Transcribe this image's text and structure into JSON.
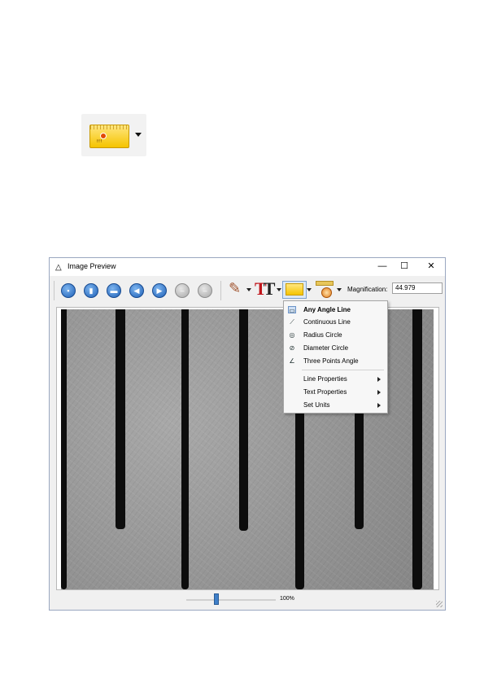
{
  "top_icon": {
    "name": "measure-tool-icon",
    "dropdown": "chevron-down-icon"
  },
  "window": {
    "title": "Image Preview",
    "controls": {
      "minimize": "—",
      "maximize": "☐",
      "close": "✕"
    }
  },
  "toolbar": {
    "buttons": [
      {
        "name": "save-icon",
        "glyph": "▪"
      },
      {
        "name": "copy-icon",
        "glyph": "▮"
      },
      {
        "name": "print-icon",
        "glyph": "▬"
      },
      {
        "name": "rotate-left-icon",
        "glyph": "◀"
      },
      {
        "name": "rotate-right-icon",
        "glyph": "▶"
      },
      {
        "name": "undo-icon",
        "glyph": "–"
      },
      {
        "name": "redo-icon",
        "glyph": "–"
      }
    ],
    "magnification_label": "Magnification:",
    "magnification_value": "44.979"
  },
  "menu": {
    "items": [
      {
        "label": "Any Angle Line",
        "icon": "any-angle-line-icon",
        "glyph": "▭",
        "selected": true
      },
      {
        "label": "Continuous Line",
        "icon": "continuous-line-icon",
        "glyph": "⟋"
      },
      {
        "label": "Radius Circle",
        "icon": "radius-circle-icon",
        "glyph": "◎"
      },
      {
        "label": "Diameter Circle",
        "icon": "diameter-circle-icon",
        "glyph": "⊘"
      },
      {
        "label": "Three Points Angle",
        "icon": "three-points-angle-icon",
        "glyph": "∠"
      }
    ],
    "submenus": [
      {
        "label": "Line Properties"
      },
      {
        "label": "Text Properties"
      },
      {
        "label": "Set Units"
      }
    ]
  },
  "status": {
    "zoom": "100%",
    "zoom_fraction": 0.35
  }
}
